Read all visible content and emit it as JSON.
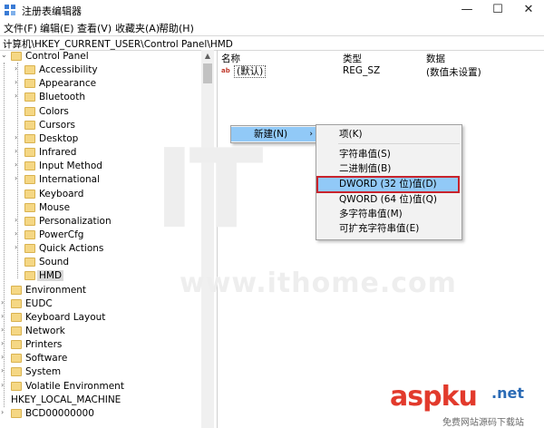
{
  "window": {
    "title": "注册表编辑器",
    "minimize_glyph": "—",
    "maximize_glyph": "☐",
    "close_glyph": "✕"
  },
  "menubar": {
    "items": [
      "文件(F)",
      "编辑(E)",
      "查看(V)",
      "收藏夹(A)",
      "帮助(H)"
    ]
  },
  "address": "计算机\\HKEY_CURRENT_USER\\Control Panel\\HMD",
  "tree": {
    "expand_glyph": "›",
    "collapse_glyph": "⌄",
    "nodes": [
      {
        "label": "Control Panel",
        "state": "expanded"
      },
      {
        "label": "Accessibility",
        "state": "collapsed"
      },
      {
        "label": "Appearance",
        "state": "collapsed"
      },
      {
        "label": "Bluetooth",
        "state": "collapsed"
      },
      {
        "label": "Colors",
        "state": "leaf"
      },
      {
        "label": "Cursors",
        "state": "leaf"
      },
      {
        "label": "Desktop",
        "state": "collapsed"
      },
      {
        "label": "Infrared",
        "state": "collapsed"
      },
      {
        "label": "Input Method",
        "state": "collapsed"
      },
      {
        "label": "International",
        "state": "collapsed"
      },
      {
        "label": "Keyboard",
        "state": "leaf"
      },
      {
        "label": "Mouse",
        "state": "leaf"
      },
      {
        "label": "Personalization",
        "state": "collapsed"
      },
      {
        "label": "PowerCfg",
        "state": "collapsed"
      },
      {
        "label": "Quick Actions",
        "state": "collapsed"
      },
      {
        "label": "Sound",
        "state": "leaf"
      },
      {
        "label": "HMD",
        "state": "selected"
      },
      {
        "label": "Environment",
        "state": "leaf"
      },
      {
        "label": "EUDC",
        "state": "collapsed"
      },
      {
        "label": "Keyboard Layout",
        "state": "collapsed"
      },
      {
        "label": "Network",
        "state": "collapsed"
      },
      {
        "label": "Printers",
        "state": "collapsed"
      },
      {
        "label": "Software",
        "state": "collapsed"
      },
      {
        "label": "System",
        "state": "collapsed"
      },
      {
        "label": "Volatile Environment",
        "state": "collapsed"
      },
      {
        "label": "HKEY_LOCAL_MACHINE",
        "state": "expanded"
      },
      {
        "label": "BCD00000000",
        "state": "collapsed"
      }
    ]
  },
  "list": {
    "headers": {
      "name": "名称",
      "type": "类型",
      "data": "数据"
    },
    "rows": [
      {
        "icon": "ab",
        "name": "(默认)",
        "type": "REG_SZ",
        "data": "(数值未设置)"
      }
    ]
  },
  "context_menu": {
    "new_label": "新建(N)",
    "arrow": "›",
    "submenu": {
      "key": "项(K)",
      "string": "字符串值(S)",
      "binary": "二进制值(B)",
      "dword": "DWORD (32 位)值(D)",
      "qword": "QWORD (64 位)值(Q)",
      "multi_string": "多字符串值(M)",
      "expandable_string": "可扩充字符串值(E)"
    }
  },
  "watermark": {
    "logo": "IT",
    "url": "www.ithome.com"
  },
  "brand": {
    "name": "aspku",
    "tld": ".net",
    "tagline": "免费网站源码下载站"
  },
  "colors": {
    "menu_highlight": "#91c9f7",
    "callout_border": "#c8232c",
    "folder": "#f5d784",
    "brand_red": "#e23a2c"
  }
}
